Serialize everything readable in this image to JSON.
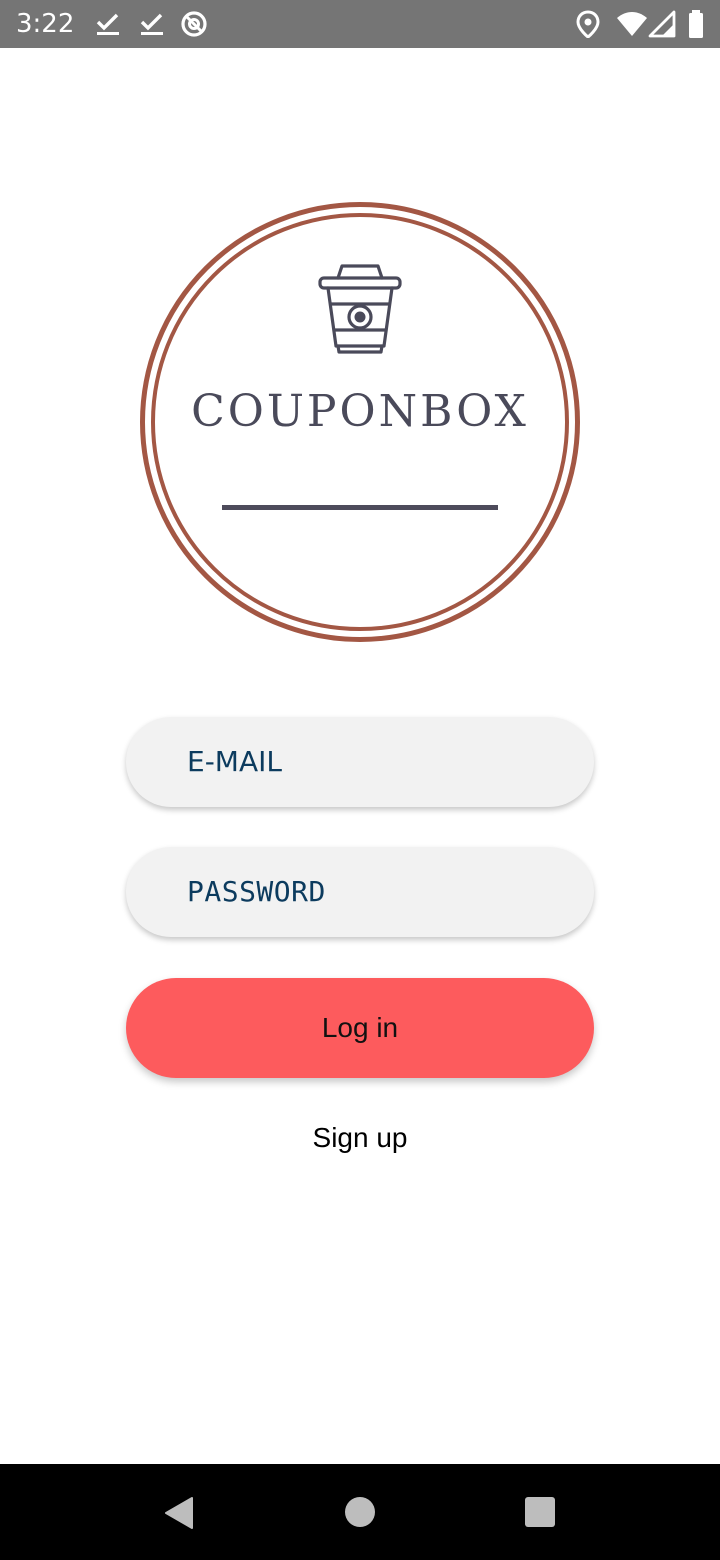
{
  "status_bar": {
    "time": "3:22",
    "left_icons": [
      "check-icon",
      "check-icon",
      "no-disturb-icon"
    ],
    "right_icons": [
      "location-icon",
      "wifi-icon",
      "cell-signal-icon",
      "battery-icon"
    ],
    "background": "#757575"
  },
  "logo": {
    "icon": "coffee-cup-icon",
    "brand": "COUPONBOX",
    "ring_color": "#a35744",
    "text_color": "#4a4a5a"
  },
  "form": {
    "email_placeholder": "E-MAIL",
    "password_placeholder": "PASSWORD",
    "login_label": "Log in",
    "signup_label": "Sign up",
    "login_color": "#fd5b5d",
    "placeholder_color": "#0c3b5e"
  },
  "nav_bar": {
    "icons": [
      "back-icon",
      "home-icon",
      "recents-icon"
    ]
  }
}
